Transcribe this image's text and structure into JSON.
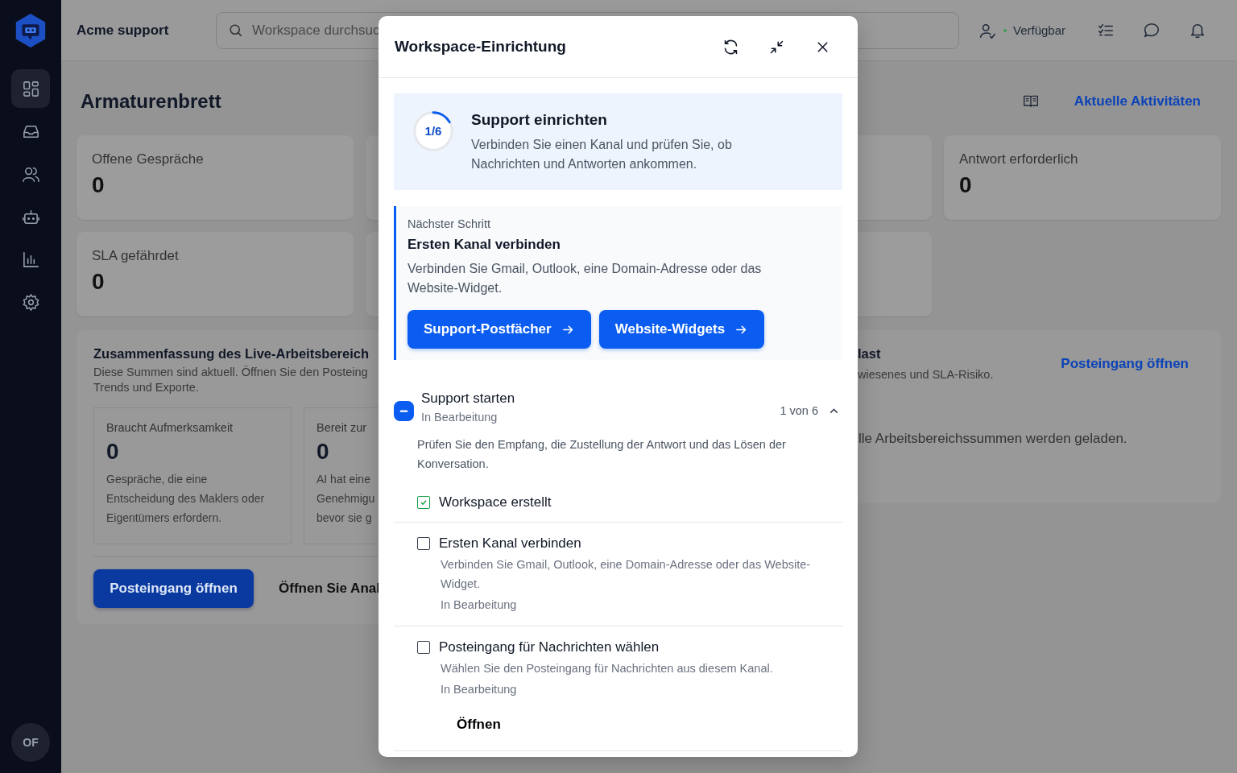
{
  "sidebar": {
    "items": [
      {
        "selected": true
      },
      {
        "selected": false
      },
      {
        "selected": false
      },
      {
        "selected": false
      },
      {
        "selected": false
      },
      {
        "selected": false
      }
    ],
    "avatar": "OF"
  },
  "topbar": {
    "workspace": "Acme support",
    "search": {
      "placeholder": "Workspace durchsuc"
    },
    "status": "Verfügbar"
  },
  "page": {
    "title": "Armaturenbrett",
    "activity_link": "Aktuelle Aktivitäten"
  },
  "stats": [
    {
      "label": "Offene Gespräche",
      "value": "0"
    },
    {
      "label": "Antwort erforderlich",
      "value": "0"
    },
    {
      "label": "SLA gefährdet",
      "value": "0"
    }
  ],
  "summary_panel": {
    "title": "Zusammenfassung des Live-Arbeitsbereich",
    "description": [
      "Diese Summen sind aktuell. Öffnen Sie den Posteing",
      "Trends und Exporte."
    ],
    "cards": [
      {
        "label": "Braucht Aufmerksamkeit",
        "value": "0",
        "description": [
          "Gespräche, die eine",
          "Entscheidung des Maklers oder",
          "Eigentümers erfordern."
        ]
      },
      {
        "label": "Bereit zur",
        "value": "0",
        "description": [
          "AI hat eine",
          "Genehmigu",
          "bevor sie g"
        ]
      }
    ],
    "primary_button": "Posteingang öffnen",
    "secondary_link": "Öffnen Sie Anal"
  },
  "workload_panel": {
    "title": "last",
    "description": "wiesenes und SLA-Risiko.",
    "link": "Posteingang öffnen",
    "message": "lle Arbeitsbereichssummen werden geladen."
  },
  "dialog": {
    "title": "Workspace-Einrichtung",
    "progress": {
      "label": "1/6",
      "level": 0.167,
      "title": "Support einrichten",
      "description": "Verbinden Sie einen Kanal und prüfen Sie, ob Nachrichten und Antworten ankommen."
    },
    "next_step": {
      "eyebrow": "Nächster Schritt",
      "title": "Ersten Kanal verbinden",
      "description": "Verbinden Sie Gmail, Outlook, eine Domain-Adresse oder das Website-Widget.",
      "buttons": [
        "Support-Postfächer",
        "Website-Widgets"
      ]
    },
    "group": {
      "title": "Support starten",
      "status": "In Bearbeitung",
      "count": "1 von 6",
      "expanded": true,
      "description": "Prüfen Sie den Empfang, die Zustellung der Antwort und das Lösen der Konversation.",
      "tasks": [
        {
          "title": "Workspace erstellt",
          "checked": true
        },
        {
          "title": "Ersten Kanal verbinden",
          "checked": false,
          "description": "Verbinden Sie Gmail, Outlook, eine Domain-Adresse oder das Website-Widget.",
          "status": "In Bearbeitung"
        },
        {
          "title": "Posteingang für Nachrichten wählen",
          "checked": false,
          "description": "Wählen Sie den Posteingang für Nachrichten aus diesem Kanal.",
          "status": "In Bearbeitung",
          "action": "Öffnen"
        }
      ]
    }
  }
}
